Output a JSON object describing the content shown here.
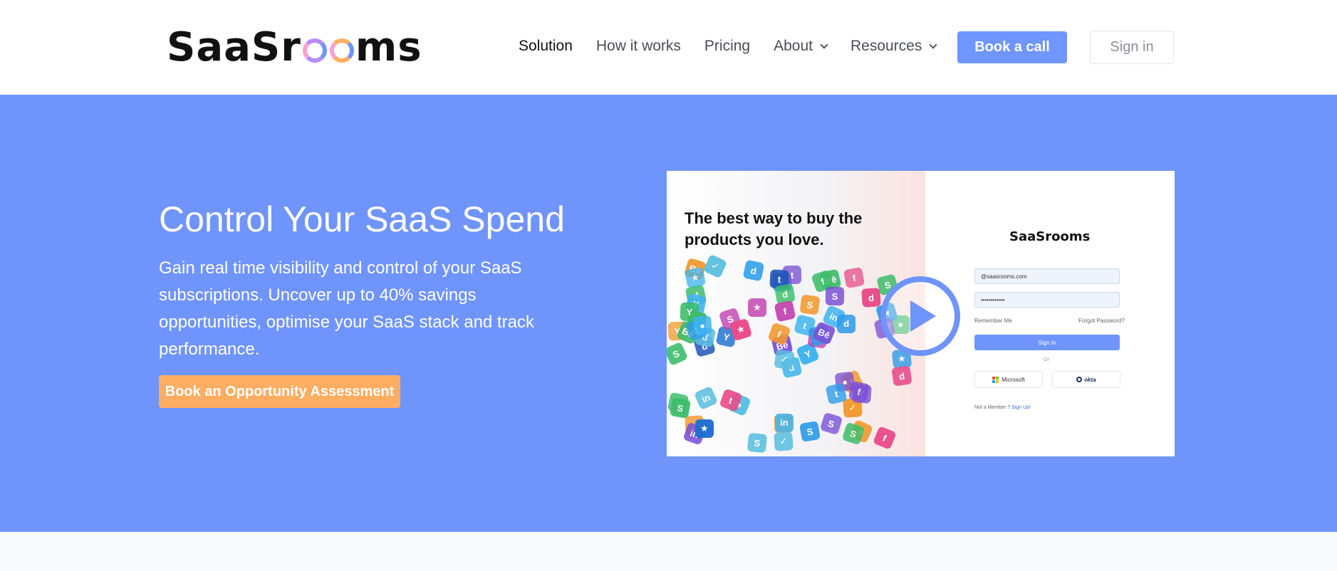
{
  "header": {
    "logo_text_left": "SaaSr",
    "logo_text_right": "ms",
    "logo_ring_colors": [
      "#b58cf5",
      "#ffad62"
    ],
    "nav": [
      {
        "label": "Solution"
      },
      {
        "label": "How it works"
      },
      {
        "label": "Pricing"
      },
      {
        "label": "About",
        "dropdown": true
      },
      {
        "label": "Resources",
        "dropdown": true
      }
    ],
    "book_call_label": "Book a call",
    "sign_in_label": "Sign in"
  },
  "hero": {
    "title": "Control Your SaaS Spend",
    "description": "Gain real time visibility and control of your SaaS subscriptions. Uncover up to 40% savings opportunities, optimise your SaaS stack and track performance.",
    "cta_label": "Book an Opportunity Assessment"
  },
  "video": {
    "heading": "The best way to buy the products you love.",
    "app_logo": "SaaSrooms",
    "email_value": "@saasrooms.com",
    "password_value": "••••••••••••",
    "remember_label": "Remember Me",
    "forgot_label": "Forgot Password?",
    "signin_label": "Sign In",
    "or_label": "Or",
    "microsoft_label": "Microsoft",
    "okta_label": "okta",
    "not_member_label": "Not a Member ?",
    "signup_label": "Sign Up!"
  },
  "colors": {
    "accent": "#6f94fc",
    "cta": "#ffad62"
  }
}
